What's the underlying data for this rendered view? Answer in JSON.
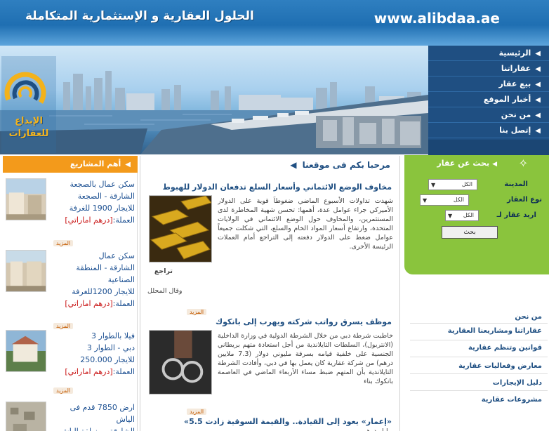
{
  "header": {
    "url": "www.alibdaa.ae",
    "slogan": "الحلول العقارية و الإستثمارية المتكاملة"
  },
  "logo": {
    "text": "الإبداع للعقارات"
  },
  "nav": {
    "items": [
      {
        "label": "الرئيسية"
      },
      {
        "label": "عقاراتنا"
      },
      {
        "label": "بيع عقار"
      },
      {
        "label": "أخبار الموقع"
      },
      {
        "label": "من نحن"
      },
      {
        "label": "إتصل بنا"
      }
    ]
  },
  "projects": {
    "heading": "أهم المشاريع",
    "more_label": "المزيد",
    "items": [
      {
        "line1": "سكن عمال بالصجعة",
        "line2": "الشارقة - الصجعة",
        "line3": "للايجار 1900 للغرفة",
        "currency_label": "العملة:",
        "currency": "[درهم اماراتي]"
      },
      {
        "line1": "سكن عمال",
        "line2": "الشارقة - المنطقة الصناعية",
        "line3": "للايجار 1200للغرفة",
        "currency_label": "العملة:",
        "currency": "[درهم اماراتي]"
      },
      {
        "line1": "فيلا بالطوار 3",
        "line2": "دبي - الطوار 3",
        "line3": "للايجار 250.000",
        "currency_label": "العملة:",
        "currency": "[درهم اماراتي]"
      },
      {
        "line1": "ارض 7850 قدم فى",
        "line2": "الياش",
        "line3": "الشارقة - منطقة الياش",
        "currency_label": "",
        "currency": ""
      }
    ]
  },
  "main": {
    "welcome": "مرحبا بكم فى موقعنا",
    "more_label": "المزيد",
    "news": [
      {
        "title": "مخاوف الوضع الائتماني وأسعار السلع تدفعان الدولار للهبوط",
        "body": "شهدت تداولات الأسبوع الماضي ضغوطاً قوية على الدولار الأميركي جراء عوامل عدة، أهمها: تحسن شهية المخاطرة لدى المستثمرين، والمخاوف حول الوضع الائتماني في الولايات المتحدة، وارتفاع أسعار المواد الخام والسلع، التي شكلت جميعاً عوامل ضغط على الدولار دفعته إلى التراجع أمام العملات الرئيسة الأخرى.",
        "extra1": "تراجع",
        "extra2": "وقال المحلل"
      },
      {
        "title": "موظف يسرق رواتب شركته ويهرب إلى بانكوك",
        "body": "خاطبت شرطة دبي من خلال الشرطة الدولية في وزارة الداخلية (الانتربول)، السلطات التايلاندية من أجل استعادة متهم بريطاني الجنسية على خلفية قيامه بسرقة مليوني دولار (7.3 ملايين درهم) من شركة عقارية كان يعمل بها في دبي، وأفادت الشرطة التايلاندية بأن المتهم ضبط مساء الأربعاء الماضي في العاصمة بانكوك بناء"
      },
      {
        "title": "«إعمار» يعود إلى القيادة.. والقيمة السوقية زادت 5.5»",
        "body": "مليار درهم"
      }
    ]
  },
  "search": {
    "title": "بحث عن عقار",
    "city_label": "المدينة",
    "type_label": "نوع العقار",
    "want_label": "اريد عقار لـ",
    "city_value": "الكل",
    "type_value": "الكل",
    "want_value": "الكل",
    "button": "بحث"
  },
  "links": {
    "items": [
      {
        "label": "من نحن"
      },
      {
        "label": "عقاراتنا ومشاريعنا العقارية"
      },
      {
        "label": "قوانين وتنظم عقارية"
      },
      {
        "label": "معارض وفعاليات عقارية"
      },
      {
        "label": "دليل الإيجارات"
      },
      {
        "label": "مشروعات عقارية"
      }
    ]
  },
  "colors": {
    "header_blue": "#1f6fb2",
    "nav_blue": "#1f4f82",
    "orange": "#f39a1b",
    "search_green": "#8ac43d",
    "price_red": "#c91414"
  }
}
